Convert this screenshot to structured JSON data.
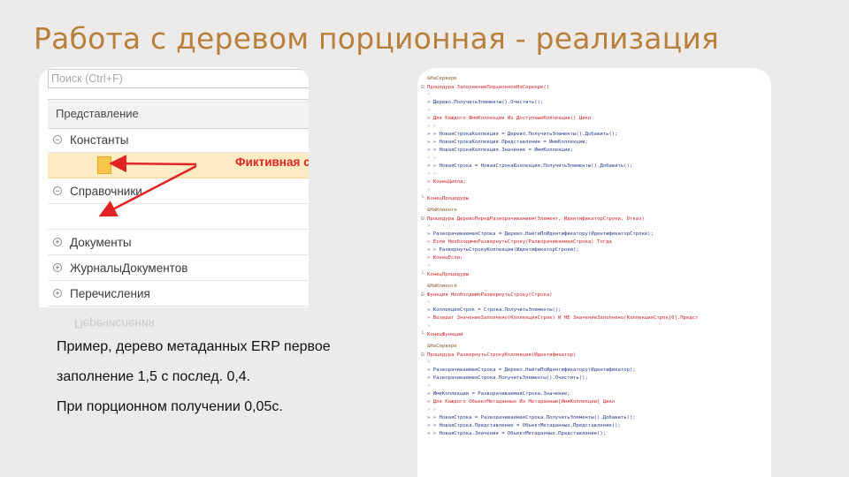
{
  "slide": {
    "title": "Работа с деревом порционная - реализация",
    "description": [
      "Пример, дерево метаданных ERP первое",
      "заполнение 1,5 с послед. 0,4.",
      "При порционном получении 0,05с."
    ]
  },
  "tree": {
    "search_placeholder": "Поиск (Ctrl+F)",
    "header": "Представление",
    "rows": [
      {
        "label": "Константы",
        "toggle": "⊖"
      },
      {
        "label": "",
        "toggle": ""
      },
      {
        "label": "Справочники",
        "toggle": "⊖"
      },
      {
        "label": "",
        "toggle": ""
      },
      {
        "label": "Документы",
        "toggle": "⊕"
      },
      {
        "label": "ЖурналыДокументов",
        "toggle": "⊕"
      },
      {
        "label": "Перечисления",
        "toggle": "⊕"
      }
    ],
    "reflection_text": "Перечисления",
    "annotation": "Фиктивная строка",
    "colors": {
      "highlight": "#fcebc3",
      "node": "#f8c54c",
      "arrow": "#e02424"
    }
  },
  "code": {
    "lines": [
      {
        "t": "&НаСервере",
        "c": "dir"
      },
      {
        "t": "Процедура ЗаполнениеПорционноеНаСервере()",
        "c": "kw",
        "m": "⊟"
      },
      {
        "t": "»",
        "c": "dot"
      },
      {
        "t": "» Дерево.ПолучитьЭлементы().Очистить();",
        "c": "id"
      },
      {
        "t": "»",
        "c": "dot"
      },
      {
        "t": "» Для Каждого ИмяКоллекции Из ДоступныеКоллекции() Цикл",
        "c": "kw"
      },
      {
        "t": "» »",
        "c": "dot"
      },
      {
        "t": "» » НоваяСтрокаКоллекция = Дерево.ПолучитьЭлементы().Добавить();",
        "c": "id"
      },
      {
        "t": "» » НоваяСтрокаКоллекция.Представление = ИмяКоллекции;",
        "c": "id"
      },
      {
        "t": "» » НоваяСтрокаКоллекция.Значение = ИмяКоллекции;",
        "c": "id"
      },
      {
        "t": "» »",
        "c": "dot"
      },
      {
        "t": "» » НоваяСтрока = НоваяСтрокаКоллекция.ПолучитьЭлементы().Добавить();",
        "c": "id"
      },
      {
        "t": "» »",
        "c": "dot"
      },
      {
        "t": "» КонецЦикла;",
        "c": "kw"
      },
      {
        "t": "»",
        "c": "dot"
      },
      {
        "t": "КонецПроцедуры",
        "c": "kw",
        "m": "└"
      },
      {
        "t": "",
        "c": "gap"
      },
      {
        "t": "&НаКлиенте",
        "c": "dir"
      },
      {
        "t": "Процедура ДеревоПередРазворачиванием(Элемент, ИдентификаторСтроки, Отказ)",
        "c": "kw",
        "m": "⊟"
      },
      {
        "t": "»",
        "c": "dot"
      },
      {
        "t": "» РазворачиваемаяСтрока = Дерево.НайтиПоИдентификатору(ИдентификаторСтроки);",
        "c": "id"
      },
      {
        "t": "» Если НеобходимоРазвернутьСтроку(РазворачиваемаяСтрока) Тогда",
        "c": "kw"
      },
      {
        "t": "» » РазвернутьСтрокуКоллекции(ИдентификаторСтроки);",
        "c": "id"
      },
      {
        "t": "» КонецЕсли;",
        "c": "kw"
      },
      {
        "t": "»",
        "c": "dot"
      },
      {
        "t": "КонецПроцедуры",
        "c": "kw",
        "m": "└"
      },
      {
        "t": "",
        "c": "gap"
      },
      {
        "t": "&НаКлиенте",
        "c": "dir"
      },
      {
        "t": "Функция НеобходимоРазвернутьСтроку(Строка)",
        "c": "kw",
        "m": "⊟"
      },
      {
        "t": "»",
        "c": "dot"
      },
      {
        "t": "» КоллекцияСтрок = Строка.ПолучитьЭлементы();",
        "c": "id"
      },
      {
        "t": "» Возврат ЗначениеЗаполнено(КоллекцияСтрок) И НЕ ЗначениеЗаполнено(КоллекцияСтрок[0].Предст",
        "c": "kw"
      },
      {
        "t": "»",
        "c": "dot"
      },
      {
        "t": "КонецФункции",
        "c": "kw",
        "m": "└"
      },
      {
        "t": "",
        "c": "gap"
      },
      {
        "t": "&НаСервере",
        "c": "dir"
      },
      {
        "t": "Процедура РазвернутьСтрокуКоллекции(Идентификатор)",
        "c": "kw",
        "m": "⊟"
      },
      {
        "t": "»",
        "c": "dot"
      },
      {
        "t": "» РазворачиваемаяСтрока = Дерево.НайтиПоИдентификатору(Идентификатор);",
        "c": "id"
      },
      {
        "t": "» РазворачиваемаяСтрока.ПолучитьЭлементы().Очистить();",
        "c": "id"
      },
      {
        "t": "»",
        "c": "dot"
      },
      {
        "t": "» ИмяКоллекции = РазворачиваемаяСтрока.Значение;",
        "c": "id"
      },
      {
        "t": "» Для Каждого ОбъектМетаданных Из Метаданные[ИмяКоллекции] Цикл",
        "c": "kw"
      },
      {
        "t": "» »",
        "c": "dot"
      },
      {
        "t": "» » НоваяСтрока = РазворачиваемаяСтрока.ПолучитьЭлементы().Добавить();",
        "c": "id"
      },
      {
        "t": "» » НоваяСтрока.Представление = ОбъектМетаданных.Представление();",
        "c": "id"
      },
      {
        "t": "» » НоваяСтрока.Значение = ОбъектМетаданных.Представление();",
        "c": "id"
      }
    ]
  }
}
